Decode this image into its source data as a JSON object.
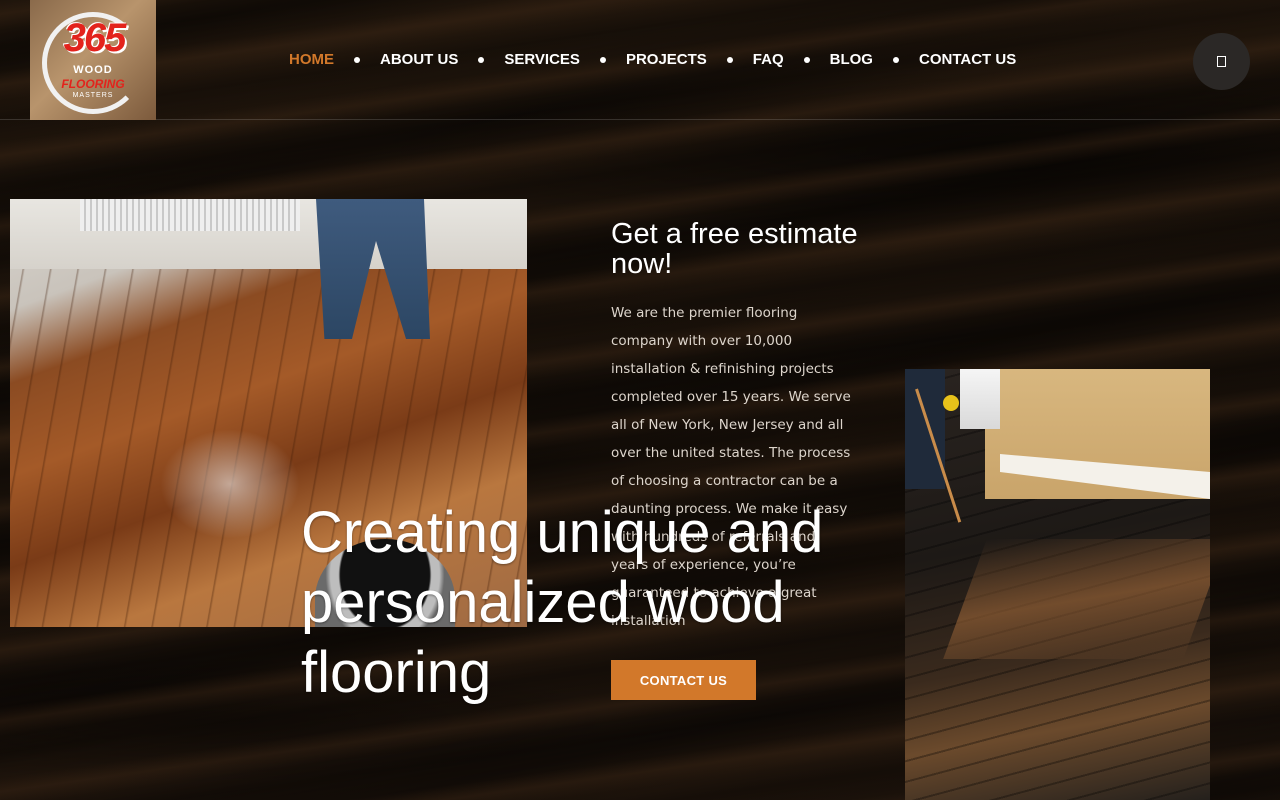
{
  "brand": {
    "logo_number": "365",
    "logo_line1": "WOOD",
    "logo_line2": "FLOORING",
    "logo_line3": "MASTERS"
  },
  "nav": {
    "items": [
      {
        "label": "HOME",
        "active": true
      },
      {
        "label": "ABOUT US",
        "active": false
      },
      {
        "label": "SERVICES",
        "active": false
      },
      {
        "label": "PROJECTS",
        "active": false
      },
      {
        "label": "FAQ",
        "active": false
      },
      {
        "label": "BLOG",
        "active": false
      },
      {
        "label": "CONTACT US",
        "active": false
      }
    ],
    "menu_icon": "square-icon"
  },
  "hero": {
    "title": "Creating unique and personalized wood flooring"
  },
  "estimate": {
    "title": "Get a free estimate now!",
    "body": "We are the premier flooring company with over 10,000 installation & refinishing projects completed over 15 years. We serve all of New York, New Jersey and all over the united states. The process of choosing a contractor can be a daunting process. We make it easy with hundreds of referrals and years of experience, you’re guaranteed to achieve a great installation",
    "cta_label": "CONTACT US"
  },
  "colors": {
    "accent": "#d2782a",
    "logo_red": "#e3231c"
  }
}
